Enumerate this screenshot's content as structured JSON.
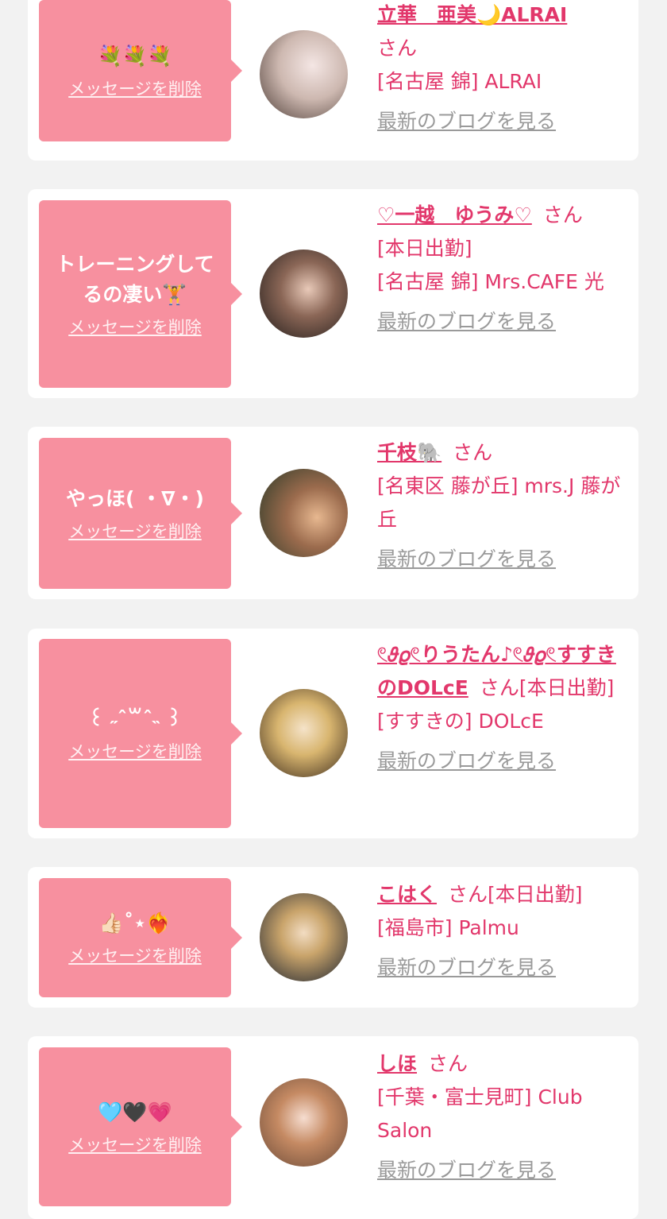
{
  "delete_label": "メッセージを削除",
  "blog_label": "最新のブログを見る",
  "san_label": "さん",
  "colors": {
    "bubble": "#f7909f",
    "accent": "#e2376b",
    "link_gray": "#9a9a9a",
    "background": "#f2f2f2"
  },
  "items": [
    {
      "message": "💐💐💐",
      "name": "立華　亜美🌙ALRAI",
      "status": "",
      "shop": "[名古屋 錦] ALRAI"
    },
    {
      "message": "トレーニングしてるの凄い🏋️",
      "name": "♡一越　ゆうみ♡",
      "status": "[本日出勤]",
      "shop": "[名古屋 錦] Mrs.CAFE 光"
    },
    {
      "message": "やっほ( ・∇・)",
      "name": "千枝🐘",
      "status": "",
      "shop": "[名東区 藤が丘] mrs.J 藤が丘"
    },
    {
      "message": "꒰ ˶ˆ꒳ˆ˵ ꒱",
      "name": "𓏲𝜗𝜚𓏲りうたん♪𓏲𝜗𝜚𓏲すすきのDOLcE",
      "status": "[本日出勤]",
      "shop": "[すすきの] DOLcE"
    },
    {
      "message": "👍🏻˚⋆❤️‍🔥",
      "name": "こはく",
      "status": "[本日出勤]",
      "shop": "[福島市] Palmu"
    },
    {
      "message": "🩵🖤💗",
      "name": "しほ",
      "status": "",
      "shop": "[千葉・富士見町] Club Salon"
    }
  ]
}
